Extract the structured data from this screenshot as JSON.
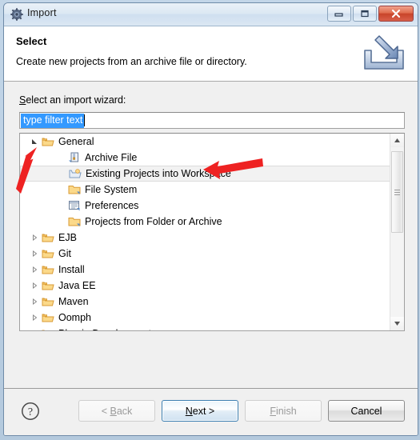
{
  "window": {
    "title": "Import",
    "icon": "gear-icon",
    "controls": {
      "minimize": "minimize-icon",
      "maximize": "maximize-icon",
      "close": "close-icon"
    }
  },
  "banner": {
    "title": "Select",
    "description": "Create new projects from an archive file or directory.",
    "icon": "import-wizard-icon"
  },
  "form": {
    "wizard_label": "Select an import wizard:",
    "filter": {
      "value": "type filter text",
      "placeholder": "type filter text",
      "selected": true
    }
  },
  "tree": {
    "rows": [
      {
        "label": "General",
        "depth": 0,
        "expanded": true,
        "icon": "open-folder-icon",
        "selected": false,
        "clipped": false
      },
      {
        "label": "Archive File",
        "depth": 1,
        "expanded": null,
        "icon": "archive-file-icon",
        "selected": false,
        "clipped": false
      },
      {
        "label": "Existing Projects into Workspace",
        "depth": 1,
        "expanded": null,
        "icon": "existing-projects-icon",
        "selected": true,
        "clipped": false
      },
      {
        "label": "File System",
        "depth": 1,
        "expanded": null,
        "icon": "folder-icon",
        "selected": false,
        "clipped": false
      },
      {
        "label": "Preferences",
        "depth": 1,
        "expanded": null,
        "icon": "preferences-icon",
        "selected": false,
        "clipped": false
      },
      {
        "label": "Projects from Folder or Archive",
        "depth": 1,
        "expanded": null,
        "icon": "folder-icon",
        "selected": false,
        "clipped": false
      },
      {
        "label": "EJB",
        "depth": 0,
        "expanded": false,
        "icon": "open-folder-icon",
        "selected": false,
        "clipped": false
      },
      {
        "label": "Git",
        "depth": 0,
        "expanded": false,
        "icon": "open-folder-icon",
        "selected": false,
        "clipped": false
      },
      {
        "label": "Install",
        "depth": 0,
        "expanded": false,
        "icon": "open-folder-icon",
        "selected": false,
        "clipped": false
      },
      {
        "label": "Java EE",
        "depth": 0,
        "expanded": false,
        "icon": "open-folder-icon",
        "selected": false,
        "clipped": false
      },
      {
        "label": "Maven",
        "depth": 0,
        "expanded": false,
        "icon": "open-folder-icon",
        "selected": false,
        "clipped": false
      },
      {
        "label": "Oomph",
        "depth": 0,
        "expanded": false,
        "icon": "open-folder-icon",
        "selected": false,
        "clipped": false
      },
      {
        "label": "Plug-in Development",
        "depth": 0,
        "expanded": false,
        "icon": "open-folder-icon",
        "selected": false,
        "clipped": true
      }
    ],
    "scrollbar": {
      "up_arrow": "scroll-up-icon",
      "down_arrow": "scroll-down-icon"
    }
  },
  "footer": {
    "help": "help-icon",
    "buttons": [
      {
        "label": "< Back",
        "state": "disabled",
        "mnemonic": "B"
      },
      {
        "label": "Next >",
        "state": "default",
        "mnemonic": "N"
      },
      {
        "label": "Finish",
        "state": "disabled",
        "mnemonic": "F"
      },
      {
        "label": "Cancel",
        "state": "enabled",
        "mnemonic": ""
      }
    ]
  },
  "annotations": {
    "color": "#ee2222",
    "arrows": [
      {
        "name": "arrow-pointing-to-general-expander",
        "target": "General expand triangle"
      },
      {
        "name": "arrow-pointing-to-existing-projects",
        "target": "Existing Projects into Workspace"
      }
    ]
  }
}
